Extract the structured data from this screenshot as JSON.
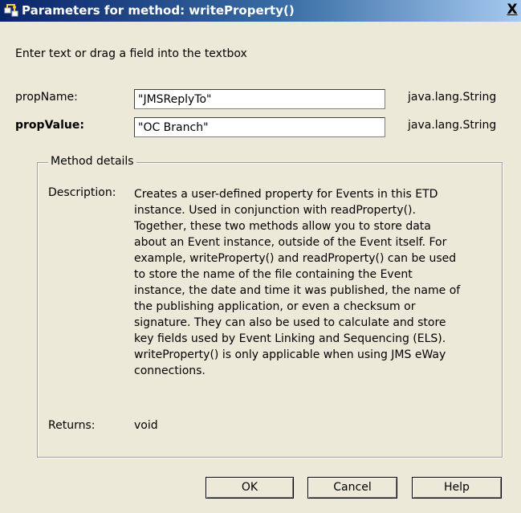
{
  "window": {
    "title": "Parameters for method: writeProperty()",
    "close_glyph": "X"
  },
  "instruction": "Enter text or drag a field into the textbox",
  "params": [
    {
      "label": "propName:",
      "value": "\"JMSReplyTo\"",
      "type": "java.lang.String"
    },
    {
      "label": "propValue:",
      "value": "\"OC Branch\"",
      "type": "java.lang.String"
    }
  ],
  "details": {
    "legend": "Method details",
    "description_label": "Description:",
    "description_lines": [
      "Creates a user-defined property for Events in this ETD",
      "instance.  Used in conjunction with readProperty().",
      "Together, these two methods allow you to store data",
      "about an Event instance, outside of the Event itself.  For",
      "example, writeProperty() and readProperty() can be used",
      "to store the name of the file containing the Event",
      "instance, the date and time it was published, the name of",
      "the publishing application, or even a checksum or",
      "signature.  They can also be used to calculate and store",
      "key fields used by Event Linking and Sequencing (ELS).",
      "writeProperty() is only applicable when using JMS eWay",
      "connections."
    ],
    "returns_label": "Returns:",
    "returns_value": "void"
  },
  "buttons": {
    "ok": "OK",
    "cancel": "Cancel",
    "help": "Help"
  }
}
